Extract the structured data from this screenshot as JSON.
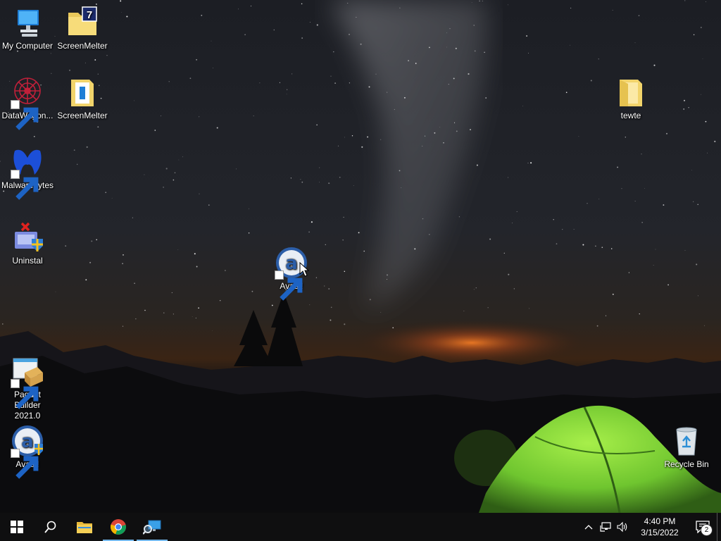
{
  "desktop": {
    "icons": [
      {
        "label": "My Computer",
        "icon": "computer-icon"
      },
      {
        "label": "ScreenMelter",
        "icon": "folder-7-icon"
      },
      {
        "label": "DataWagon...",
        "icon": "datawagon-icon"
      },
      {
        "label": "ScreenMelter",
        "icon": "folder-doc-icon"
      },
      {
        "label": "tewte",
        "icon": "folder-icon"
      },
      {
        "label": "Malwarebytes",
        "icon": "malwarebytes-icon"
      },
      {
        "label": "Uninstal",
        "icon": "uninstal-icon"
      },
      {
        "label": "Avast!",
        "icon": "avast-icon"
      },
      {
        "label": "Paquet Builder 2021.0",
        "icon": "paquet-builder-icon"
      },
      {
        "label": "Avast!",
        "icon": "avast-icon"
      },
      {
        "label": "Recycle Bin",
        "icon": "recycle-bin-icon"
      }
    ]
  },
  "taskbar": {
    "start": "windows-start-icon",
    "search": "search-icon",
    "pinned": [
      "file-explorer-icon",
      "chrome-icon",
      "network-search-icon"
    ],
    "tray": {
      "chevron": "chevron-up-icon",
      "network": "network-icon",
      "volume": "volume-icon",
      "time": "4:40 PM",
      "date": "3/15/2022",
      "notification_count": "2"
    }
  },
  "colors": {
    "taskbar": "#0f0f10",
    "active_indicator": "#76b9ed",
    "tent": "#7ed13a",
    "horizon_glow": "#e8661c"
  }
}
